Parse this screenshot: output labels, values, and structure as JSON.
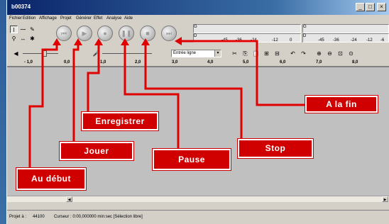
{
  "window": {
    "title": "b00374",
    "controls": {
      "minimize": "_",
      "maximize": "□",
      "close": "×"
    }
  },
  "menu": [
    "Fichier",
    "Edition",
    "Affichage",
    "Projet",
    "Générer",
    "Effet",
    "Analyse",
    "Aide"
  ],
  "toolbar": {
    "tools": {
      "selection": "I",
      "envelope": "⁓",
      "draw": "✎",
      "zoom": "⚲",
      "timeshift": "↔",
      "multi": "✱"
    },
    "transport": {
      "skip_start": "⏮",
      "play": "▶",
      "record": "●",
      "pause": "❚❚",
      "stop": "■",
      "skip_end": "⏭"
    },
    "output_meter": {
      "channels": [
        "G",
        "D"
      ],
      "ticks": [
        "-45",
        "-36",
        "-24",
        "-12",
        "0"
      ]
    },
    "input_meter": {
      "channels": [
        "G",
        "D"
      ],
      "ticks": [
        "-45",
        "-36",
        "-24",
        "-12",
        "-6"
      ]
    },
    "mixer": {
      "volume_icon": "speaker-icon",
      "mic_icon": "mic-icon"
    },
    "input_source": "Entrée ligne",
    "edit_icons": [
      "cut",
      "copy",
      "paste",
      "trim",
      "silence",
      "undo",
      "redo",
      "zoom-in",
      "zoom-out",
      "fit",
      "zoom-sel"
    ]
  },
  "ruler": {
    "labels": [
      "- 1,0",
      "0,0",
      "1,0",
      "2,0",
      "3,0",
      "4,0",
      "5,0",
      "6,0",
      "7,0",
      "8,0"
    ]
  },
  "status": {
    "rate_label": "Projet à :",
    "rate_value": "44100",
    "cursor": "Curseur : 0:00,000000 min:sec  [Sélection libre]"
  },
  "annotations": {
    "debut": "Au début",
    "jouer": "Jouer",
    "enregistrer": "Enregistrer",
    "pause": "Pause",
    "stop": "Stop",
    "fin": "A la fin"
  },
  "colors": {
    "annotation": "#d10000",
    "titlebar": "#0a246a",
    "track_area": "#c0c0c0"
  }
}
